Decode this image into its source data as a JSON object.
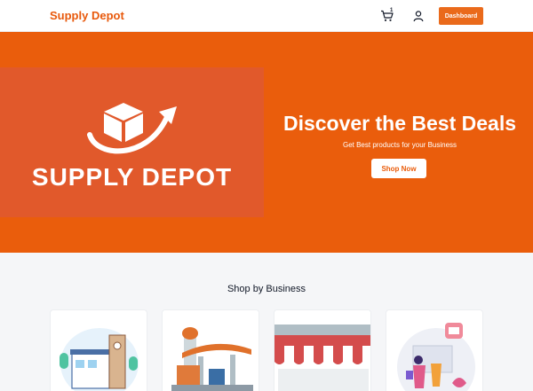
{
  "header": {
    "brand": "Supply Depot",
    "cart_count": "1",
    "dashboard_label": "Dashboard"
  },
  "hero": {
    "logo_text": "SUPPLY DEPOT",
    "title": "Discover the Best Deals",
    "subtitle": "Get Best products for your Business",
    "cta_label": "Shop Now"
  },
  "section": {
    "title": "Shop by Business"
  },
  "icons": {
    "cart": "cart-icon",
    "user": "user-icon"
  },
  "colors": {
    "brand": "#e8590c",
    "hero_bg": "#ea5d0c",
    "logo_panel": "#e1592b",
    "section_bg": "#f5f6f8"
  }
}
